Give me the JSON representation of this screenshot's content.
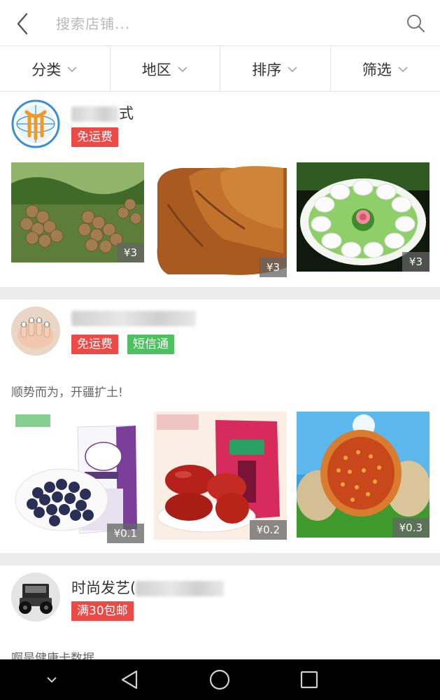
{
  "search": {
    "placeholder": "搜索店铺..."
  },
  "filters": [
    {
      "label": "分类"
    },
    {
      "label": "地区"
    },
    {
      "label": "排序"
    },
    {
      "label": "筛选"
    }
  ],
  "shops": [
    {
      "name_visible": "式",
      "tags": [
        "免运费"
      ],
      "products": [
        {
          "price": "¥3",
          "desc": "longan"
        },
        {
          "price": "¥3",
          "desc": "dried-meat"
        },
        {
          "price": "¥3",
          "desc": "rice-cake-plate"
        }
      ]
    },
    {
      "tags": [
        "免运费",
        "短信通"
      ],
      "slogan": "顺势而为，开疆扩土!",
      "products": [
        {
          "price": "¥0.1",
          "desc": "raisins"
        },
        {
          "price": "¥0.2",
          "desc": "red-dates"
        },
        {
          "price": "¥0.3",
          "desc": "figs"
        }
      ]
    },
    {
      "name_visible": "时尚发艺(",
      "tags": [
        "满30包邮"
      ],
      "slogan": "啊是健康卡数据"
    }
  ],
  "colors": {
    "tag_red": "#ec4a47",
    "tag_green": "#4fbf62",
    "divider": "#ececec"
  },
  "icons": [
    "back-arrow-icon",
    "search-icon",
    "chevron-down-icon",
    "nav-collapse-icon",
    "nav-back-icon",
    "nav-home-icon",
    "nav-recents-icon"
  ]
}
